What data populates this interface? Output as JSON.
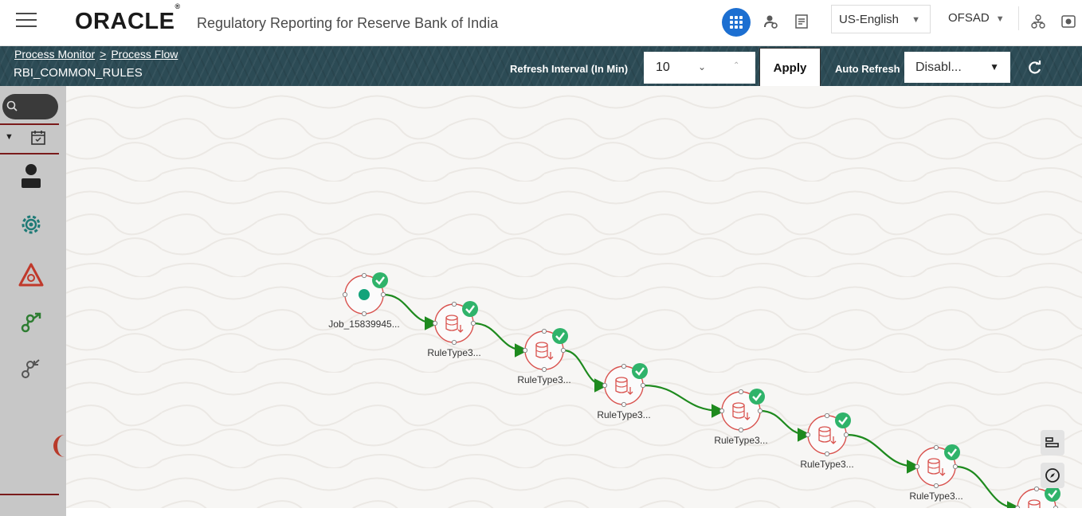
{
  "header": {
    "logo": "ORACLE",
    "logo_mark": "®",
    "app_title": "Regulatory Reporting for Reserve Bank of India",
    "language": "US-English",
    "user": "OFSAD"
  },
  "breadcrumb": {
    "items": [
      "Process Monitor",
      "Process Flow"
    ],
    "separator": ">"
  },
  "page_title": "RBI_COMMON_RULES",
  "refresh": {
    "interval_label": "Refresh Interval (In Min)",
    "interval_value": "10",
    "apply_label": "Apply",
    "auto_label": "Auto Refresh",
    "auto_value": "Disabl..."
  },
  "flow": {
    "nodes": [
      {
        "label": "Job_15839945...",
        "kind": "start",
        "status": "success"
      },
      {
        "label": "RuleType3...",
        "kind": "rule",
        "status": "success"
      },
      {
        "label": "RuleType3...",
        "kind": "rule",
        "status": "success"
      },
      {
        "label": "RuleType3...",
        "kind": "rule",
        "status": "success"
      },
      {
        "label": "RuleType3...",
        "kind": "rule",
        "status": "success"
      },
      {
        "label": "RuleType3...",
        "kind": "rule",
        "status": "success"
      },
      {
        "label": "RuleType3...",
        "kind": "rule",
        "status": "success"
      },
      {
        "label": "",
        "kind": "rule",
        "status": "success"
      }
    ]
  },
  "colors": {
    "brand_blue": "#1c6fd1",
    "banner": "#2c4b55",
    "success_green": "#2fb36a",
    "edge_green": "#1e8a1e",
    "node_red": "#d9534f"
  }
}
